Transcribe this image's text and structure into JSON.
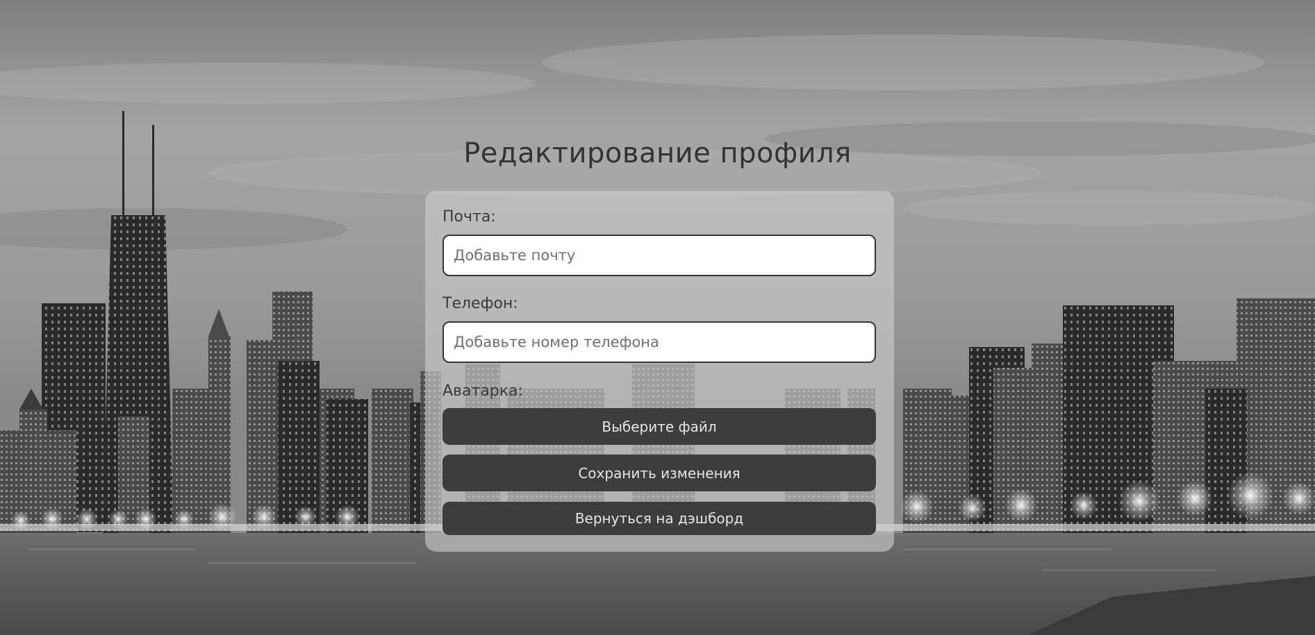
{
  "page": {
    "title": "Редактирование профиля"
  },
  "form": {
    "email": {
      "label": "Почта:",
      "value": "",
      "placeholder": "Добавьте почту"
    },
    "phone": {
      "label": "Телефон:",
      "value": "",
      "placeholder": "Добавьте номер телефона"
    },
    "avatar": {
      "label": "Аватарка:",
      "choose_file_label": "Выберите файл"
    },
    "save_label": "Сохранить изменения",
    "back_label": "Вернуться на дэшборд"
  },
  "background": {
    "description_icon": "city-skyline-background",
    "sky_color": "#9a9a9a",
    "water_color": "#5a5a5a"
  }
}
